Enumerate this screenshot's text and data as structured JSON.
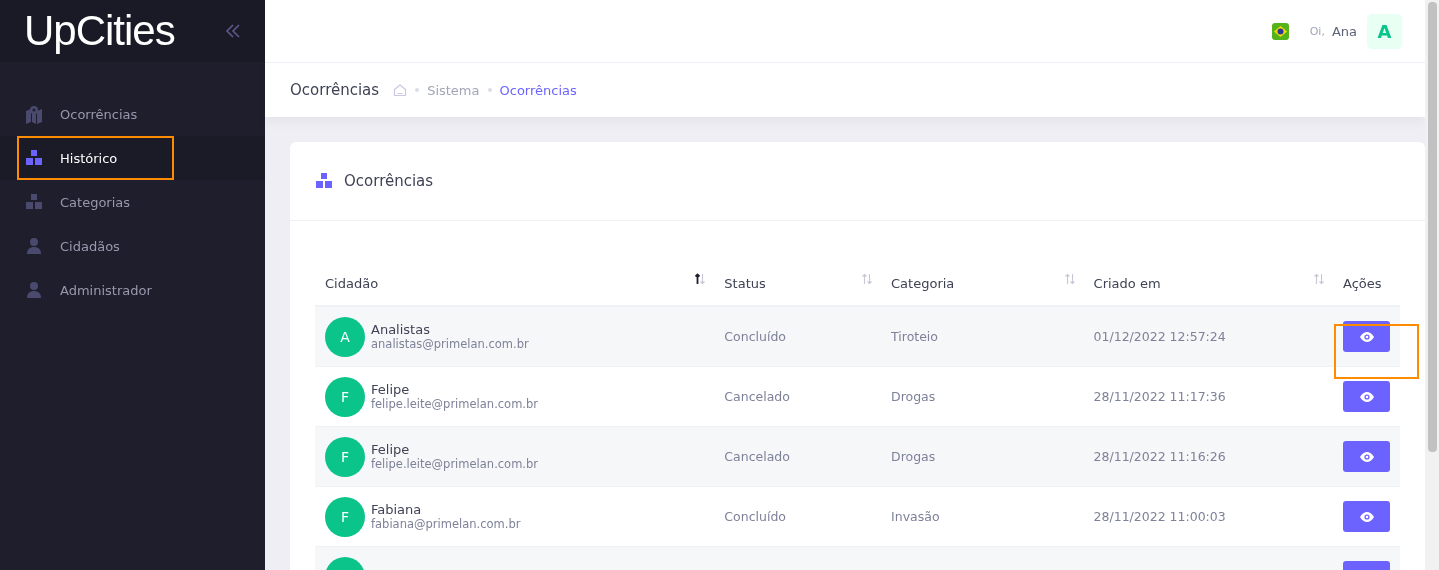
{
  "sidebar": {
    "logo": "UpCities",
    "items": [
      {
        "label": "Ocorrências",
        "selected": false,
        "highlighted": false
      },
      {
        "label": "Histórico",
        "selected": true,
        "highlighted": true
      },
      {
        "label": "Categorias",
        "selected": false,
        "highlighted": false
      },
      {
        "label": "Cidadãos",
        "selected": false,
        "highlighted": false
      },
      {
        "label": "Administrador",
        "selected": false,
        "highlighted": false
      }
    ]
  },
  "topbar": {
    "greeting": "Oi,",
    "user_name": "Ana",
    "avatar_letter": "A"
  },
  "page_header": {
    "title": "Ocorrências",
    "breadcrumb": [
      {
        "label": "Sistema",
        "selected": false
      },
      {
        "label": "Ocorrências",
        "selected": true
      }
    ]
  },
  "card": {
    "title": "Ocorrências",
    "table": {
      "columns": [
        {
          "label": "Cidadão",
          "sorted": true
        },
        {
          "label": "Status",
          "sorted": false
        },
        {
          "label": "Categoria",
          "sorted": false
        },
        {
          "label": "Criado em",
          "sorted": false
        },
        {
          "label": "Ações"
        }
      ],
      "rows": [
        {
          "kind": "full",
          "avatar_letter": "A",
          "name": "Analistas",
          "email": "analistas@primelan.com.br",
          "status": "Concluído",
          "category": "Tiroteio",
          "created": "01/12/2022 12:57:24",
          "highlighted": true
        },
        {
          "kind": "full",
          "avatar_letter": "F",
          "name": "Felipe",
          "email": "felipe.leite@primelan.com.br",
          "status": "Cancelado",
          "category": "Drogas",
          "created": "28/11/2022 11:17:36",
          "highlighted": false
        },
        {
          "kind": "full",
          "avatar_letter": "F",
          "name": "Felipe",
          "email": "felipe.leite@primelan.com.br",
          "status": "Cancelado",
          "category": "Drogas",
          "created": "28/11/2022 11:16:26",
          "highlighted": false
        },
        {
          "kind": "full",
          "avatar_letter": "F",
          "name": "Fabiana",
          "email": "fabiana@primelan.com.br",
          "status": "Concluído",
          "category": "Invasão",
          "created": "28/11/2022 11:00:03",
          "highlighted": false
        },
        {
          "kind": "partial",
          "highlighted": false
        }
      ]
    }
  }
}
